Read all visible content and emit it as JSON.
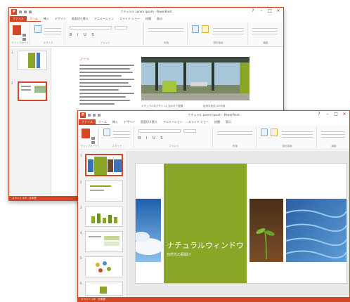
{
  "back_window": {
    "title": "ナチュラル Lorem Ipsum - PowerPoint",
    "tabs": [
      "ファイル",
      "ホーム",
      "挿入",
      "デザイン",
      "画面切り替え",
      "アニメーション",
      "スライド ショー",
      "校閲",
      "表示"
    ],
    "groups": [
      "クリップボード",
      "スライド",
      "フォント",
      "段落",
      "図形描画",
      "編集"
    ],
    "thumb_numbers": [
      "1",
      "2"
    ],
    "notes_heading": "ノート",
    "caption_left": "ナチュラルなデザインに合わせて配置",
    "caption_right": "自然な色合いの写真",
    "status": "スライド 2/3　日本語"
  },
  "front_window": {
    "title": "ナチュラル Lorem Ipsum - PowerPoint",
    "tabs": [
      "ファイル",
      "ホーム",
      "挿入",
      "デザイン",
      "画面切り替え",
      "アニメーション",
      "スライド ショー",
      "校閲",
      "表示"
    ],
    "groups": [
      "クリップボード",
      "スライド",
      "フォント",
      "段落",
      "図形描画",
      "編集"
    ],
    "thumb_numbers": [
      "1",
      "2",
      "3",
      "4",
      "5",
      "6"
    ],
    "slide_title": "ナチュラルウィンドウ",
    "slide_subtitle": "自然光の幕開け",
    "status": "スライド 1/6　日本語"
  },
  "colors": {
    "accent": "#d24726",
    "green": "#8aa626"
  }
}
